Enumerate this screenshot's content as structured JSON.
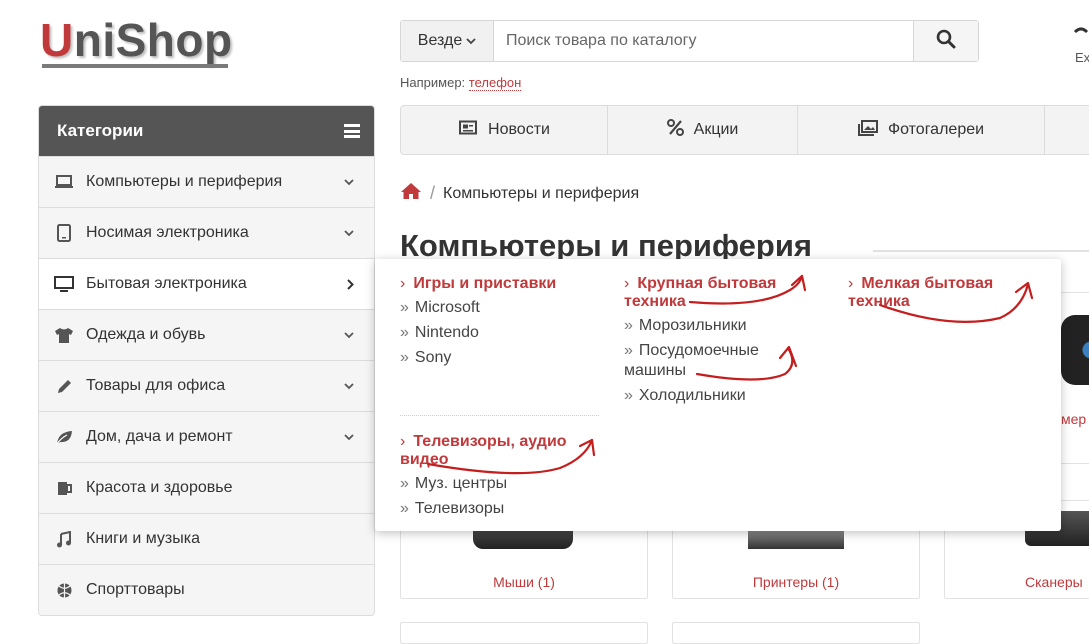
{
  "logo": {
    "first": "U",
    "rest": "niShop"
  },
  "search": {
    "scope": "Везде",
    "placeholder": "Поиск товара по каталогу",
    "example_prefix": "Например:",
    "example_link": "телефон"
  },
  "header_right": {
    "label": "Ex"
  },
  "sidebar": {
    "title": "Категории",
    "items": [
      {
        "label": "Компьютеры и периферия",
        "icon": "laptop-icon"
      },
      {
        "label": "Носимая электроника",
        "icon": "tablet-icon"
      },
      {
        "label": "Бытовая электроника",
        "icon": "monitor-icon"
      },
      {
        "label": "Одежда и обувь",
        "icon": "tshirt-icon"
      },
      {
        "label": "Товары для офиса",
        "icon": "pencil-icon"
      },
      {
        "label": "Дом, дача и ремонт",
        "icon": "leaf-icon"
      },
      {
        "label": "Красота и здоровье",
        "icon": "mug-icon"
      },
      {
        "label": "Книги и музыка",
        "icon": "music-icon"
      },
      {
        "label": "Спорттовары",
        "icon": "ball-icon"
      }
    ]
  },
  "nav": {
    "tabs": [
      {
        "label": "Новости",
        "icon": "newspaper-icon"
      },
      {
        "label": "Акции",
        "icon": "percent-icon"
      },
      {
        "label": "Фотогалереи",
        "icon": "images-icon"
      }
    ]
  },
  "breadcrumb": {
    "current": "Компьютеры и периферия"
  },
  "page": {
    "title": "Компьютеры и периферия"
  },
  "mega_menu": {
    "groups": [
      {
        "title": "Игры и приставки",
        "items": [
          "Microsoft",
          "Nintendo",
          "Sony"
        ]
      },
      {
        "title": "Крупная бытовая техника",
        "items": [
          "Морозильники",
          "Посудомоечные машины",
          "Холодильники"
        ]
      },
      {
        "title": "Мелкая бытовая техника",
        "items": []
      },
      {
        "title": "Телевизоры, аудио видео",
        "items": [
          "Муз. центры",
          "Телевизоры"
        ]
      }
    ]
  },
  "products": [
    {
      "caption": "Мыши (1)"
    },
    {
      "caption": "Принтеры (1)"
    },
    {
      "caption": "Сканеры"
    }
  ],
  "partial_label": "мер",
  "colors": {
    "accent": "#c0393b",
    "sidebar_header": "#555555"
  }
}
